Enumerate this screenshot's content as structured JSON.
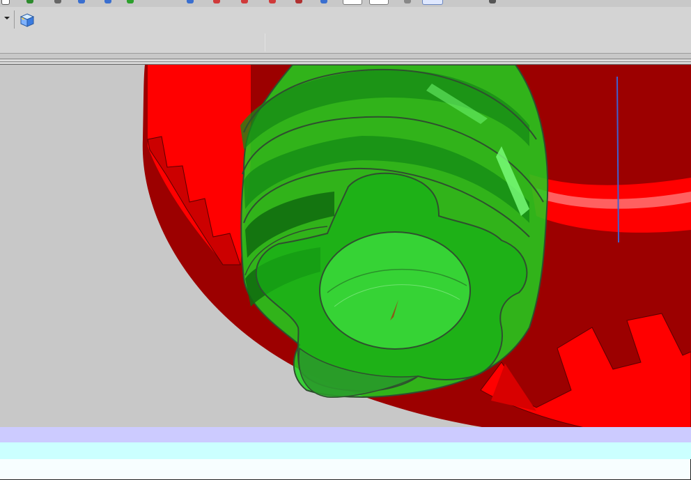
{
  "toolbar": {
    "dropdown_icon": "chevron-down-icon",
    "view_cube_icon": "view-cube-icon"
  },
  "viewport": {
    "model": {
      "worm_color": "#1fd21f",
      "worm_edge_color": "#2f4f2f",
      "gear_color": "#ff0000",
      "gear_shadow_color": "#9c0000",
      "axis_color": "#4060d0"
    },
    "background": "#c8c8c8"
  },
  "status_bands": {
    "band1_color": "#cccbff",
    "band2_color": "#cbffff",
    "band3_color": "#f7feff"
  }
}
